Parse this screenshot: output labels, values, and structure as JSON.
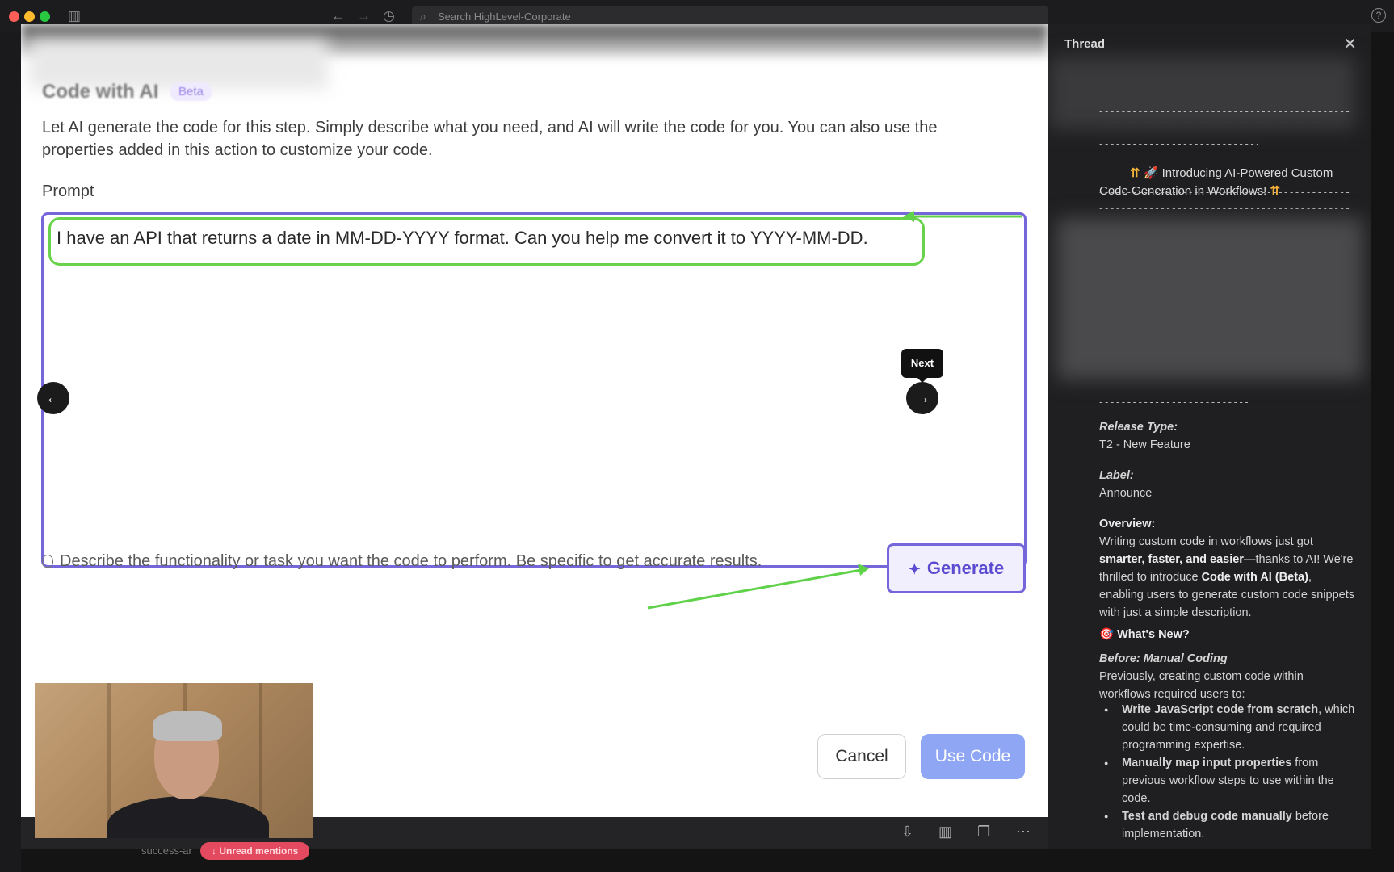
{
  "topbar": {
    "search_placeholder": "Search HighLevel-Corporate",
    "help": "?"
  },
  "modal": {
    "title": "Code with AI",
    "beta": "Beta",
    "description": "Let AI generate the code for this step. Simply describe what you need, and AI will write the code for you. You can also use the properties added in this action to customize your code.",
    "prompt_label": "Prompt",
    "prompt_value": "I have an API that returns a date in MM-DD-YYYY format. Can you help me convert it to YYYY-MM-DD.",
    "tooltip_next": "Next",
    "hint": "Describe the functionality or task you want the code to perform. Be specific to get accurate results.",
    "generate_label": "Generate",
    "cancel_label": "Cancel",
    "use_code_label": "Use Code"
  },
  "bottom": {
    "channel_snippet": "success-ar",
    "unread_chip": "Unread mentions"
  },
  "thread": {
    "title": "Thread",
    "intro": "Introducing AI-Powered Custom Code Generation in Workflows!",
    "release_type_label": "Release Type:",
    "release_type_value": "T2 - New Feature",
    "label_label": "Label:",
    "label_value": "Announce",
    "overview_label": "Overview:",
    "overview_p1": "Writing custom code in workflows just got ",
    "overview_b1": "smarter, faster, and easier",
    "overview_p2": "—thanks to AI! We're thrilled to introduce ",
    "overview_b2": "Code with AI (Beta)",
    "overview_p3": ", enabling users to generate custom code snippets with just a simple description.",
    "whats_new": "What's New?",
    "before_heading": "Before: Manual Coding",
    "before_text": "Previously, creating custom code within workflows required users to:",
    "bullets": [
      {
        "bold": "Write JavaScript code from scratch",
        "rest": ", which could be time-consuming and required programming expertise."
      },
      {
        "bold": "Manually map input properties",
        "rest": " from previous workflow steps to use within the code."
      },
      {
        "bold": "Test and debug code manually",
        "rest": " before implementation."
      }
    ]
  }
}
